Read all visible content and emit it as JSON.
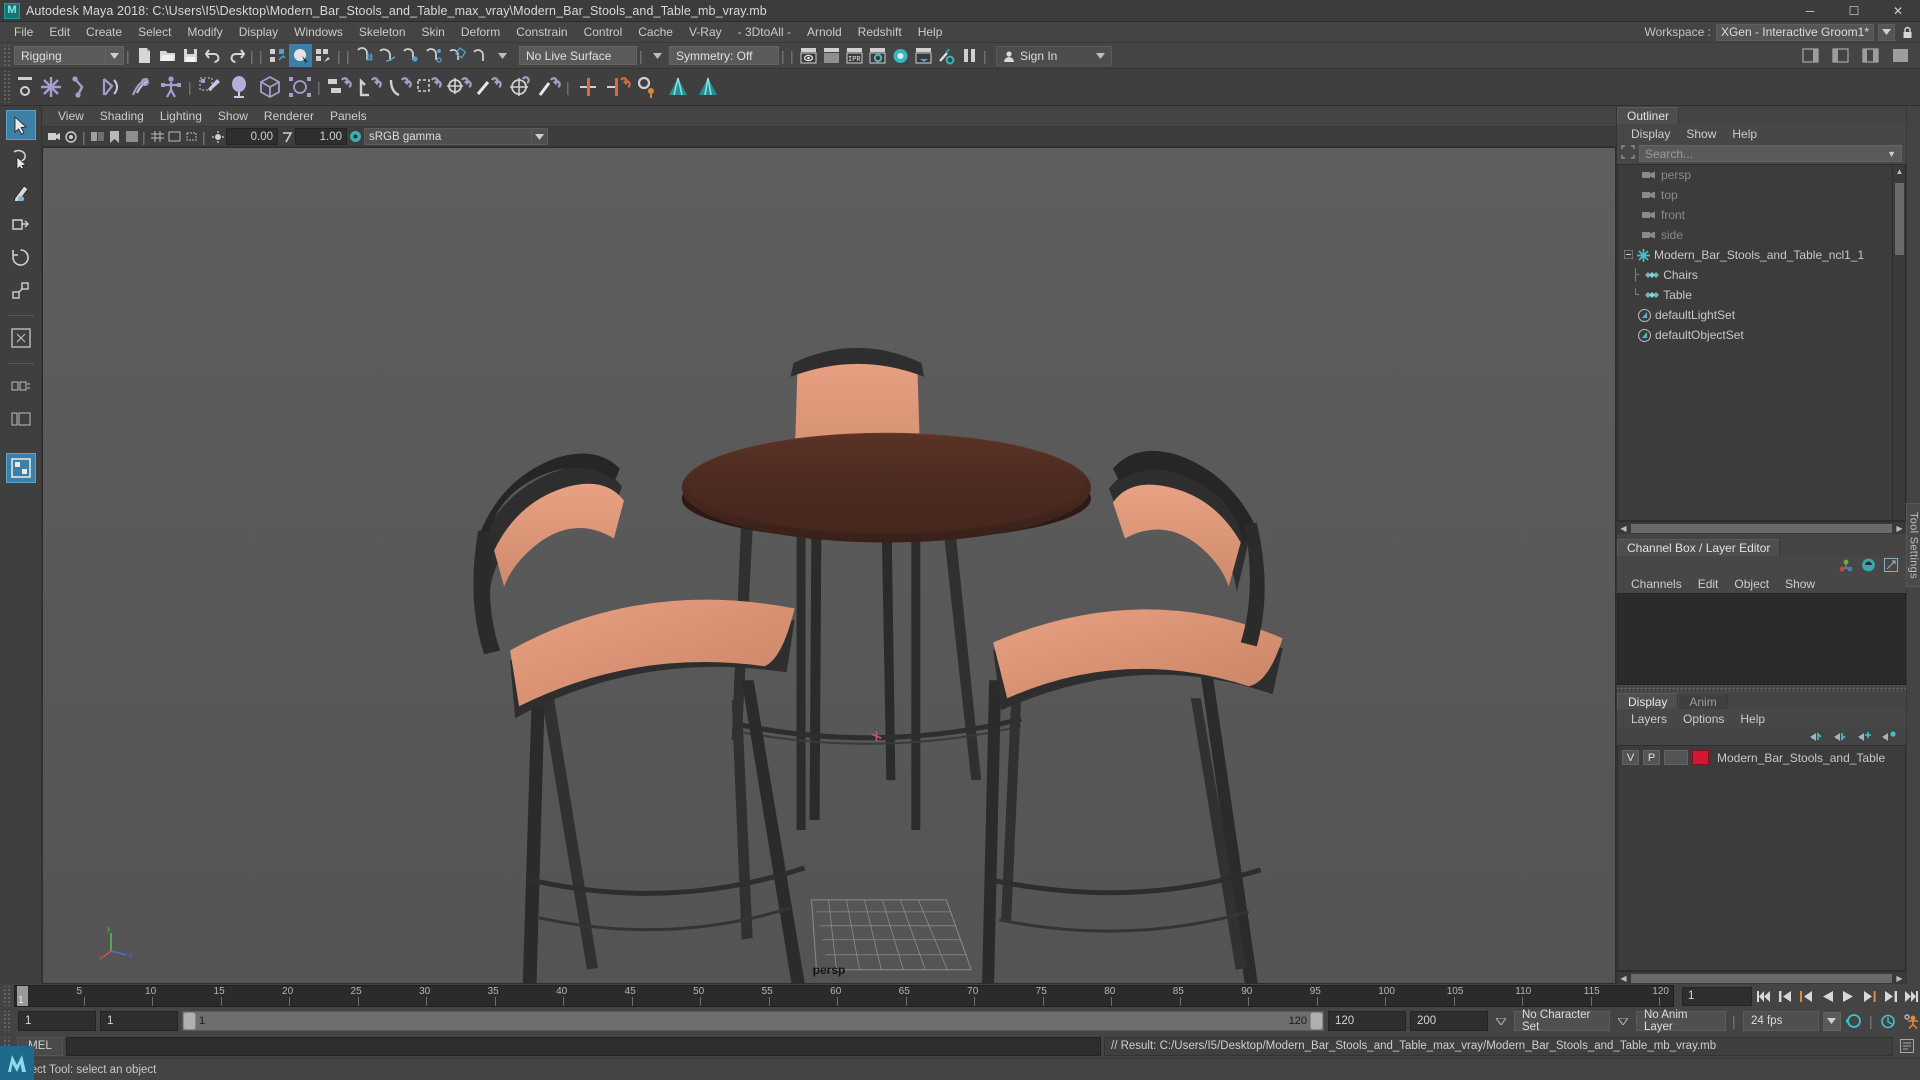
{
  "window": {
    "title": "Autodesk Maya 2018: C:\\Users\\I5\\Desktop\\Modern_Bar_Stools_and_Table_max_vray\\Modern_Bar_Stools_and_Table_mb_vray.mb",
    "logo": "maya-logo",
    "minimize": "─",
    "maximize": "☐",
    "close": "✕"
  },
  "menubar": {
    "items": [
      "File",
      "Edit",
      "Create",
      "Select",
      "Modify",
      "Display",
      "Windows",
      "Skeleton",
      "Skin",
      "Deform",
      "Constrain",
      "Control",
      "Cache",
      "V-Ray",
      "- 3DtoAll -",
      "Arnold",
      "Redshift",
      "Help"
    ],
    "workspace_label": "Workspace :",
    "workspace_value": "XGen - Interactive Groom1*",
    "lock_icon": "lock-icon"
  },
  "statusline": {
    "menuset": "Rigging",
    "live_surface": "No Live Surface",
    "symmetry": "Symmetry: Off",
    "num_field_a": "",
    "num_field_b": "",
    "signin": "Sign In",
    "icons": [
      "new-scene-icon",
      "open-scene-icon",
      "save-scene-icon",
      "undo-icon",
      "redo-icon",
      "select-by-hierarchy-icon",
      "select-by-object-icon",
      "select-by-component-icon",
      "snap-to-grid-icon",
      "snap-to-curve-icon",
      "snap-to-point-icon",
      "snap-to-projected-center-icon",
      "snap-to-view-plane-icon",
      "magnet-icon",
      "render-current-frame-icon",
      "ipr-render-icon",
      "render-settings-icon",
      "hypershade-icon",
      "render-view-icon",
      "light-settings-icon",
      "pause-icon"
    ]
  },
  "shelf": {
    "icons": [
      "joint-tool-icon",
      "ik-handle-icon",
      "ik-spline-handle-icon",
      "quick-rig-icon",
      "human-ik-icon",
      "paint-skin-weights-icon",
      "deformer-lattice-icon",
      "lattice-icon",
      "cluster-icon",
      "parent-constraint-icon",
      "point-constraint-icon",
      "orient-constraint-icon",
      "scale-constraint-icon",
      "aim-constraint-icon",
      "pole-vector-icon",
      "mirror-joint-icon",
      "mirror-skin-icon",
      "connect-joint-icon",
      "bake-icon",
      "xgen-groom-icon",
      "xgen-desc-icon"
    ]
  },
  "toolbox": {
    "tools": [
      "select-tool",
      "lasso-select-tool",
      "paint-select-tool",
      "move-tool",
      "rotate-tool",
      "scale-tool",
      "soft-mod-tool",
      "show-manipulator-tool",
      "last-tool-used",
      "single-view-layout",
      "four-view-layout",
      "persp-outliner-layout",
      "hypershade-layout"
    ]
  },
  "viewport": {
    "menus": [
      "View",
      "Shading",
      "Lighting",
      "Show",
      "Renderer",
      "Panels"
    ],
    "exposure": "0.00",
    "gamma_value": "1.00",
    "colorspace": "sRGB gamma",
    "camera_label": "persp",
    "axis": {
      "x": "x",
      "y": "y",
      "z": "z"
    },
    "scene_description": "Modern bar stools and round table 3D model in perspective view"
  },
  "outliner": {
    "tab": "Outliner",
    "menus": [
      "Display",
      "Show",
      "Help"
    ],
    "search_placeholder": "Search...",
    "items": [
      {
        "label": "persp",
        "icon": "camera-icon",
        "indent": 1,
        "dim": true
      },
      {
        "label": "top",
        "icon": "camera-icon",
        "indent": 1,
        "dim": true
      },
      {
        "label": "front",
        "icon": "camera-icon",
        "indent": 1,
        "dim": true
      },
      {
        "label": "side",
        "icon": "camera-icon",
        "indent": 1,
        "dim": true
      },
      {
        "label": "Modern_Bar_Stools_and_Table_ncl1_1",
        "icon": "nucleus-icon",
        "indent": 0,
        "dim": false,
        "expander": "minus"
      },
      {
        "label": "Chairs",
        "icon": "mesh-group-icon",
        "indent": 2,
        "dim": false
      },
      {
        "label": "Table",
        "icon": "mesh-group-icon",
        "indent": 2,
        "dim": false
      },
      {
        "label": "defaultLightSet",
        "icon": "set-icon",
        "indent": 1,
        "dim": false
      },
      {
        "label": "defaultObjectSet",
        "icon": "set-icon",
        "indent": 1,
        "dim": false
      }
    ]
  },
  "tool_settings_tab": "Tool Settings",
  "channelbox": {
    "tab": "Channel Box / Layer Editor",
    "menus": [
      "Channels",
      "Edit",
      "Object",
      "Show"
    ],
    "header_icons": [
      "channel-box-icon",
      "attribute-editor-icon",
      "modeling-toolkit-icon"
    ]
  },
  "layereditor": {
    "tabs": [
      {
        "label": "Display",
        "active": true
      },
      {
        "label": "Anim",
        "active": false
      }
    ],
    "menus": [
      "Layers",
      "Options",
      "Help"
    ],
    "buttons": [
      "move-layer-up-icon",
      "move-layer-down-icon",
      "new-layer-icon",
      "new-layer-from-selected-icon"
    ],
    "layers": [
      {
        "visibility": "V",
        "playback": "P",
        "shading": "",
        "color": "#d41732",
        "name": "Modern_Bar_Stools_and_Table"
      }
    ]
  },
  "timeline": {
    "ticks": [
      5,
      10,
      15,
      20,
      25,
      30,
      35,
      40,
      45,
      50,
      55,
      60,
      65,
      70,
      75,
      80,
      85,
      90,
      95,
      100,
      105,
      110,
      115,
      120
    ],
    "current_frame": "1",
    "playback_field": "1",
    "transport": [
      "go-to-start-icon",
      "step-back-key-icon",
      "step-back-frame-icon",
      "play-backwards-icon",
      "play-forwards-icon",
      "step-forward-frame-icon",
      "step-forward-key-icon",
      "go-to-end-icon"
    ]
  },
  "rangeslider": {
    "start": "1",
    "end": "1",
    "range_left": "1",
    "range_right": "120",
    "anim_end": "120",
    "playback_end": "200",
    "character_set": "No Character Set",
    "anim_layer": "No Anim Layer",
    "fps": "24 fps",
    "icons": [
      "auto-key-icon",
      "animation-preferences-icon",
      "loop-playback-icon"
    ]
  },
  "commandline": {
    "mel_label": "MEL",
    "input_value": "",
    "result": "// Result: C:/Users/I5/Desktop/Modern_Bar_Stools_and_Table_max_vray/Modern_Bar_Stools_and_Table_mb_vray.mb",
    "script_editor_icon": "script-editor-icon"
  },
  "helpline": {
    "text": "Select Tool: select an object"
  }
}
